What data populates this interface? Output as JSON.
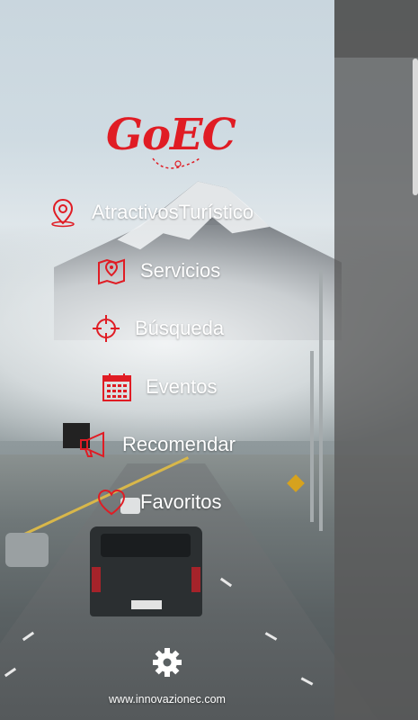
{
  "app": {
    "logo_text": "GoEC",
    "brand_color": "#e01c24"
  },
  "menu": {
    "items": [
      {
        "label": "AtractivosTurístico",
        "icon": "map-pin-icon"
      },
      {
        "label": "Servicios",
        "icon": "map-location-icon"
      },
      {
        "label": "Búsqueda",
        "icon": "crosshair-icon"
      },
      {
        "label": "Eventos",
        "icon": "calendar-icon"
      },
      {
        "label": "Recomendar",
        "icon": "megaphone-icon"
      },
      {
        "label": "Favoritos",
        "icon": "heart-icon"
      }
    ]
  },
  "footer": {
    "settings_icon": "gear-icon",
    "website": "www.innovazionec.com"
  }
}
